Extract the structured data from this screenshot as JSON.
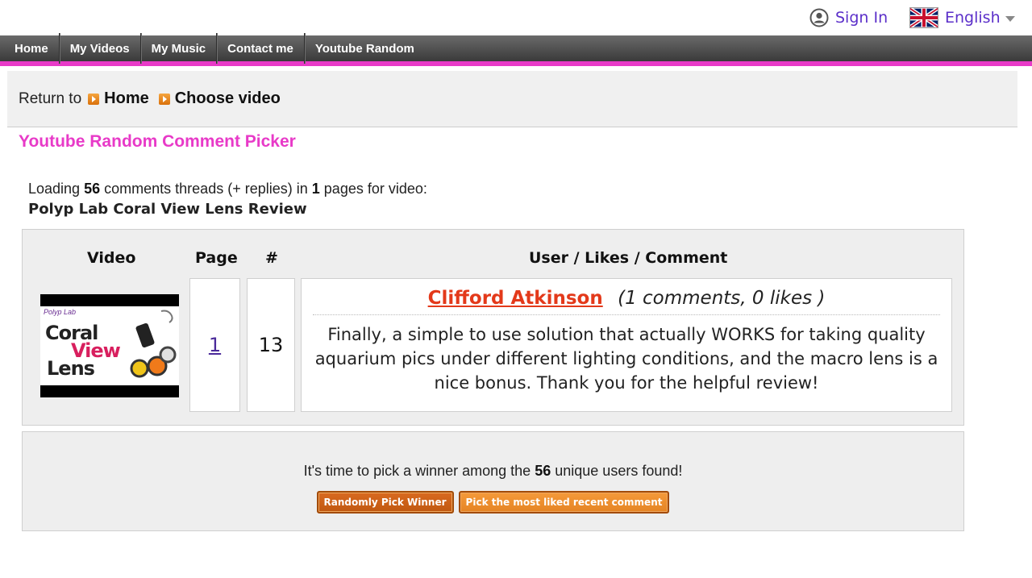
{
  "topbar": {
    "signin_label": "Sign In",
    "language_label": "English"
  },
  "nav": {
    "items": [
      {
        "label": "Home"
      },
      {
        "label": "My Videos"
      },
      {
        "label": "My Music"
      },
      {
        "label": "Contact me"
      },
      {
        "label": "Youtube Random"
      }
    ]
  },
  "breadcrumb": {
    "prefix": "Return to",
    "links": [
      "Home",
      "Choose video"
    ]
  },
  "page_title": "Youtube Random Comment Picker",
  "loading": {
    "prefix": "Loading",
    "threads": "56",
    "middle": "comments threads (+ replies) in",
    "pages": "1",
    "suffix": "pages for video:",
    "video_title": "Polyp Lab Coral View Lens Review"
  },
  "table": {
    "headers": [
      "Video",
      "Page",
      "#",
      "User / Likes / Comment"
    ],
    "thumbnail": {
      "line1": "Coral",
      "line2": "View",
      "line3": "Lens"
    },
    "row": {
      "page": "1",
      "number": "13",
      "user": "Clifford Atkinson",
      "stats": "(1 comments, 0 likes )",
      "comment": "Finally, a simple to use solution that actually WORKS for taking quality aquarium pics under different lighting conditions, and the macro lens is a nice bonus. Thank you for the helpful review!"
    }
  },
  "winner": {
    "msg_prefix": "It's time to pick a winner among the",
    "count": "56",
    "msg_suffix": "unique users found!",
    "random_button": "Randomly Pick Winner",
    "liked_button": "Pick the most liked recent comment"
  },
  "colors": {
    "accent_pink": "#e83ac8",
    "link_purple": "#5b2fc9",
    "username_red": "#e3391a",
    "button_orange": "#d96a20"
  }
}
